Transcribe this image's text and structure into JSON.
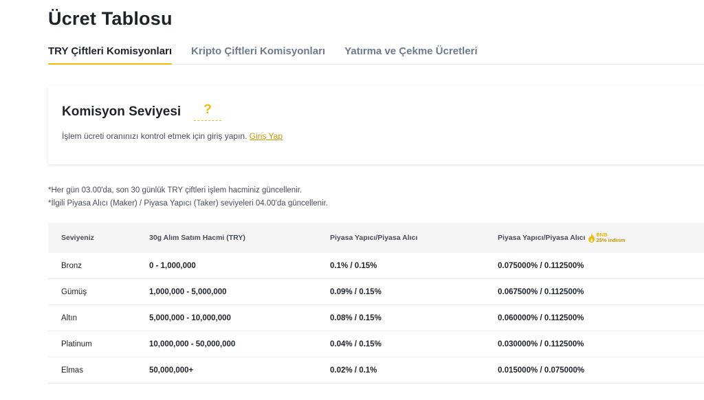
{
  "page": {
    "title": "Ücret Tablosu"
  },
  "tabs": [
    {
      "label": "TRY Çiftleri Komisyonları",
      "active": true
    },
    {
      "label": "Kripto Çiftleri Komisyonları",
      "active": false
    },
    {
      "label": "Yatırma ve Çekme Ücretleri",
      "active": false
    }
  ],
  "commission": {
    "title": "Komisyon Seviyesi",
    "help": "?",
    "text": "İşlem ücreti oranınızı kontrol etmek için giriş yapın. ",
    "login_link": "Giriş Yap"
  },
  "notes": [
    "*Her gün 03.00'da, son 30 günlük TRY çiftleri işlem hacminiz güncellenir.",
    "*İlgili Piyasa Alıcı (Maker) / Piyasa Yapıcı (Taker) seviyeleri 04.00'da güncellenir."
  ],
  "table": {
    "headers": [
      "Seviyeniz",
      "30g Alım Satım Hacmi (TRY)",
      "Piyasa Yapıcı/Piyasa Alıcı",
      "Piyasa Yapıcı/Piyasa Alıcı"
    ],
    "bnb_badge": {
      "line1": "BNB",
      "line2": "25% indirim"
    },
    "rows": [
      [
        "Bronz",
        "0 - 1,000,000",
        "0.1% / 0.15%",
        "0.075000% / 0.112500%"
      ],
      [
        "Gümüş",
        "1,000,000 - 5,000,000",
        "0.09% / 0.15%",
        "0.067500% / 0.112500%"
      ],
      [
        "Altın",
        "5,000,000 - 10,000,000",
        "0.08% / 0.15%",
        "0.060000% / 0.112500%"
      ],
      [
        "Platinum",
        "10,000,000 - 50,000,000",
        "0.04% / 0.15%",
        "0.030000% / 0.112500%"
      ],
      [
        "Elmas",
        "50,000,000+",
        "0.02% / 0.1%",
        "0.015000% / 0.075000%"
      ]
    ]
  },
  "colors": {
    "accent": "#f0b90b",
    "link": "#c99400",
    "text": "#1e2329",
    "muted": "#707a8a"
  },
  "icons": {
    "help": "question-mark-icon",
    "bnb": "flame-icon"
  }
}
